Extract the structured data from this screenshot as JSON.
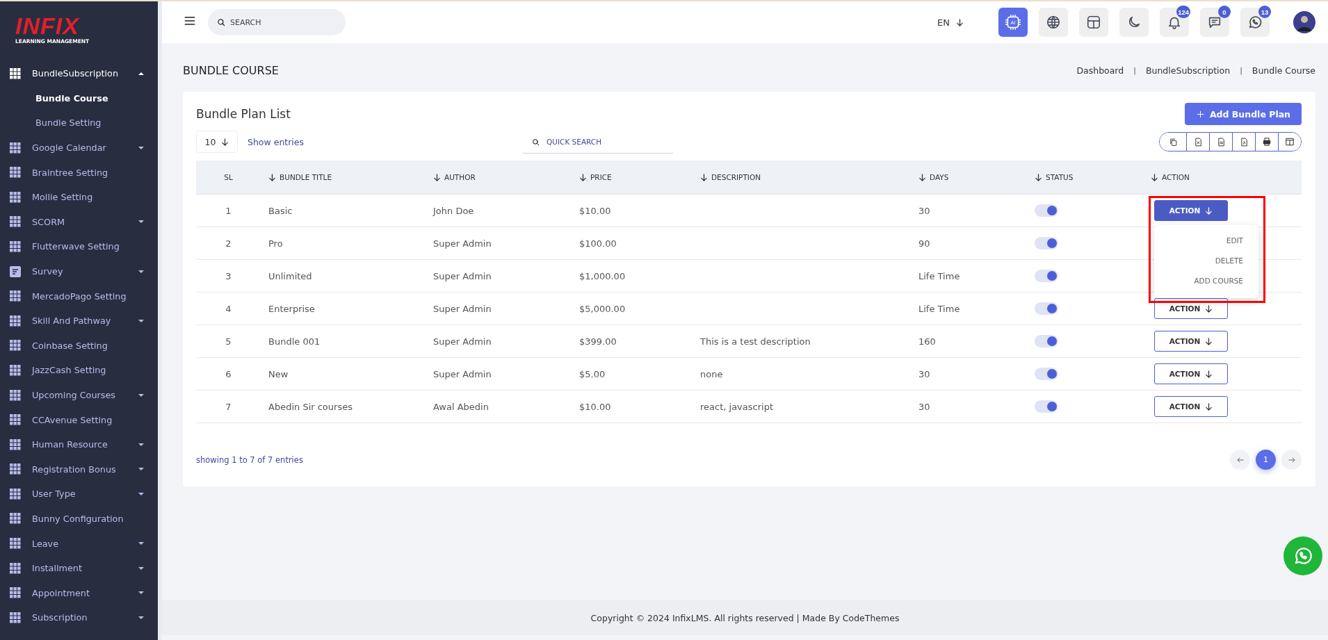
{
  "sidebar": {
    "logo": {
      "title": "INFIX",
      "subtitle": "LEARNING MANAGEMENT"
    },
    "items": [
      {
        "label": "BundleSubscription",
        "kind": "group",
        "expanded": true,
        "children": [
          {
            "label": "Bundle Course",
            "selected": true
          },
          {
            "label": "Bundle Setting",
            "selected": false
          }
        ]
      },
      {
        "label": "Google Calendar",
        "kind": "group",
        "expanded": false
      },
      {
        "label": "Braintree Setting",
        "kind": "link"
      },
      {
        "label": "Mollie Setting",
        "kind": "link"
      },
      {
        "label": "SCORM",
        "kind": "group",
        "expanded": false
      },
      {
        "label": "Flutterwave Setting",
        "kind": "link"
      },
      {
        "label": "Survey",
        "kind": "formgroup",
        "expanded": false
      },
      {
        "label": "MercadoPago Setting",
        "kind": "link"
      },
      {
        "label": "Skill And Pathway",
        "kind": "group",
        "expanded": false
      },
      {
        "label": "Coinbase Setting",
        "kind": "link"
      },
      {
        "label": "JazzCash Setting",
        "kind": "link"
      },
      {
        "label": "Upcoming Courses",
        "kind": "group",
        "expanded": false
      },
      {
        "label": "CCAvenue Setting",
        "kind": "link"
      },
      {
        "label": "Human Resource",
        "kind": "group",
        "expanded": false
      },
      {
        "label": "Registration Bonus",
        "kind": "group",
        "expanded": false
      },
      {
        "label": "User Type",
        "kind": "group",
        "expanded": false
      },
      {
        "label": "Bunny Configuration",
        "kind": "link"
      },
      {
        "label": "Leave",
        "kind": "group",
        "expanded": false
      },
      {
        "label": "Installment",
        "kind": "group",
        "expanded": false
      },
      {
        "label": "Appointment",
        "kind": "group",
        "expanded": false
      },
      {
        "label": "Subscription",
        "kind": "group",
        "expanded": false
      }
    ]
  },
  "header": {
    "search": {
      "placeholder": "SEARCH"
    },
    "language": "EN",
    "icons": [
      {
        "kind": "ai",
        "label": "AI",
        "active": true
      },
      {
        "kind": "globe",
        "active": false
      },
      {
        "kind": "layout",
        "active": false
      },
      {
        "kind": "moon",
        "active": false
      },
      {
        "kind": "bell",
        "badge": "124",
        "active": false
      },
      {
        "kind": "chat",
        "badge": "0",
        "active": false
      },
      {
        "kind": "whatsapp",
        "badge": "13",
        "active": false
      }
    ]
  },
  "page": {
    "title": "BUNDLE COURSE",
    "breadcrumb": [
      {
        "kind": "link",
        "label": "Dashboard"
      },
      {
        "kind": "separator",
        "label": "|"
      },
      {
        "kind": "link",
        "label": "BundleSubscription"
      },
      {
        "kind": "separator",
        "label": "|"
      },
      {
        "kind": "link",
        "label": "Bundle Course"
      }
    ]
  },
  "card": {
    "title": "Bundle Plan List",
    "add_button": "Add Bundle Plan",
    "entries": {
      "value": "10",
      "label": "Show entries"
    },
    "quick_search": {
      "placeholder": "QUICK SEARCH"
    },
    "table": {
      "columns": [
        {
          "label": "SL",
          "sortable": false
        },
        {
          "label": "BUNDLE TITLE",
          "sortable": true
        },
        {
          "label": "AUTHOR",
          "sortable": true
        },
        {
          "label": "PRICE",
          "sortable": true
        },
        {
          "label": "DESCRIPTION",
          "sortable": true
        },
        {
          "label": "DAYS",
          "sortable": true
        },
        {
          "label": "STATUS",
          "sortable": true
        },
        {
          "label": "ACTION",
          "sortable": true
        }
      ],
      "rows": [
        {
          "sl": "1",
          "title": "Basic",
          "author": "John Doe",
          "price": "$10.00",
          "days": "30",
          "on": true,
          "action": "ACTION",
          "expanded": true,
          "menu": [
            "EDIT",
            "DELETE",
            "ADD COURSE"
          ]
        },
        {
          "sl": "2",
          "title": "Pro",
          "author": "Super Admin",
          "price": "$100.00",
          "days": "90",
          "on": true
        },
        {
          "sl": "3",
          "title": "Unlimited",
          "author": "Super Admin",
          "price": "$1,000.00",
          "days": "Life Time",
          "on": true
        },
        {
          "sl": "4",
          "title": "Enterprise",
          "author": "Super Admin",
          "price": "$5,000.00",
          "days": "Life Time",
          "on": true,
          "action": "ACTION",
          "expanded": false
        },
        {
          "sl": "5",
          "title": "Bundle 001",
          "author": "Super Admin",
          "price": "$399.00",
          "description": "This is a test description",
          "days": "160",
          "on": true,
          "action": "ACTION",
          "expanded": false
        },
        {
          "sl": "6",
          "title": "New",
          "author": "Super Admin",
          "price": "$5.00",
          "description": "none",
          "days": "30",
          "on": true,
          "action": "ACTION",
          "expanded": false
        },
        {
          "sl": "7",
          "title": "Abedin Sir courses",
          "author": "Awal Abedin",
          "price": "$10.00",
          "description": "react, javascript",
          "days": "30",
          "on": true,
          "action": "ACTION",
          "expanded": false
        }
      ]
    },
    "footer_text": "showing 1 to 7 of 7 entries",
    "pagination": [
      {
        "label": "1",
        "selected": true
      }
    ]
  },
  "footer": "Copyright © 2024 InfixLMS. All rights reserved | Made By CodeThemes"
}
